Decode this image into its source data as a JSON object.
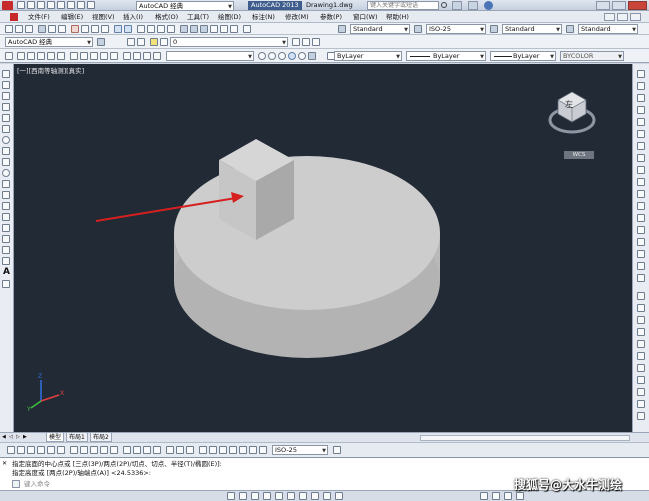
{
  "title_bar": {
    "workspace": "AutoCAD 经典",
    "app_title": "AutoCAD 2013",
    "file_name": "Drawing1.dwg",
    "search_placeholder": "键入关键字或短语"
  },
  "menu": [
    "文件(F)",
    "编辑(E)",
    "视图(V)",
    "插入(I)",
    "格式(O)",
    "工具(T)",
    "绘图(D)",
    "标注(N)",
    "修改(M)",
    "参数(P)",
    "窗口(W)",
    "帮助(H)"
  ],
  "toolbar": {
    "workspace_combo": "AutoCAD 经典",
    "layer_combo": "0",
    "text_style": "Standard",
    "dim_style": "ISO-25",
    "table_style": "Standard",
    "multileader_style": "Standard",
    "color": "ByLayer",
    "linetype": "ByLayer",
    "lineweight": "ByLayer",
    "plotstyle": "BYCOLOR"
  },
  "viewport": {
    "label": "[一][西南等轴测][真实]",
    "viewcube_face": "左",
    "wcs": "WCS",
    "ucs_axes": {
      "x": "X",
      "y": "Y",
      "z": "Z"
    },
    "colors": {
      "background": "#222a36",
      "solid": "#c8c8c8",
      "arrow": "#d61f1f"
    }
  },
  "tabs": [
    "模型",
    "布局1",
    "布局2"
  ],
  "annotation": {
    "scale": "ISO-25"
  },
  "command": {
    "line1": "指定底面的中心点或 [三点(3P)/两点(2P)/切点、切点、半径(T)/椭圆(E)]:",
    "line2": "指定高度或 [两点(2P)/轴端点(A)] <24.5336>:",
    "prompt": "键入命令"
  },
  "watermark": "搜狐号@大水牛测绘"
}
